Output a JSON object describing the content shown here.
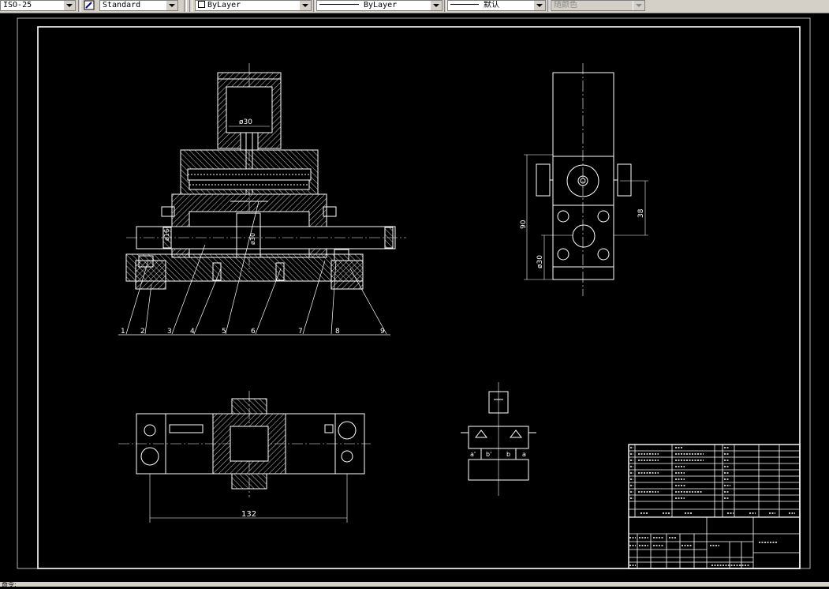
{
  "toolbar": {
    "dimstyle_value": "ISO-25",
    "textstyle_value": "Standard",
    "layer_value": "ByLayer",
    "linetype_value": "ByLayer",
    "lineweight_value": "默认",
    "plotstyle_value": "随颜色"
  },
  "drawing": {
    "part_labels": [
      "1",
      "2",
      "3",
      "4",
      "5",
      "6",
      "7",
      "8",
      "9"
    ],
    "dims": {
      "d_top_bore": "ø30",
      "d_shaft": "ø16",
      "d_center": "ø30",
      "side_overall": "90",
      "side_upper": "38",
      "side_hole": "ø30",
      "plan_length": "132"
    },
    "symbol_labels": {
      "a_left": "a'",
      "b_left": "b'",
      "b_right": "b",
      "a_right": "a"
    }
  },
  "status_bar": {
    "text": "命令: "
  }
}
